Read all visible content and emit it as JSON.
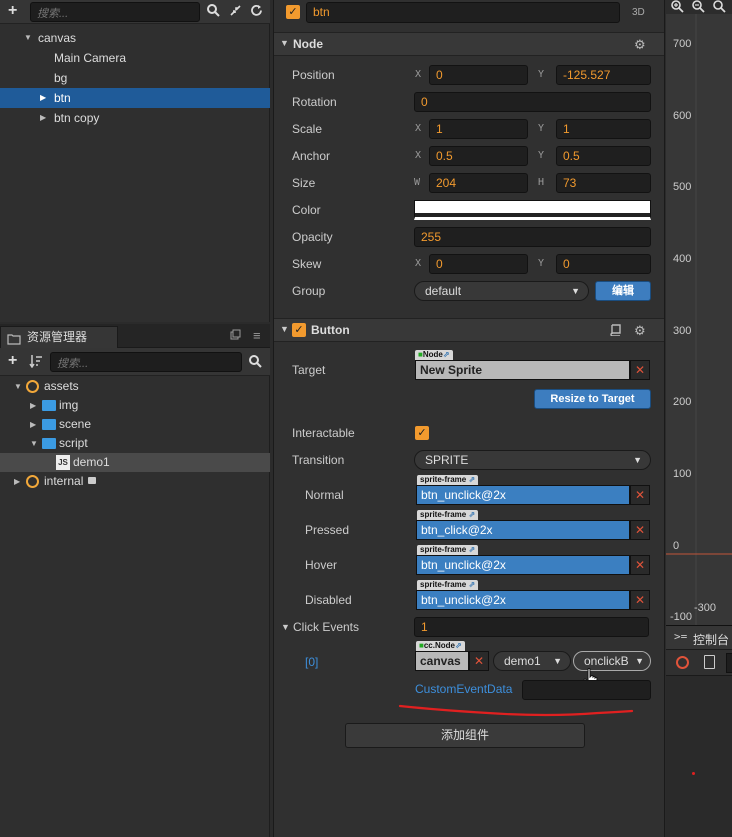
{
  "hierarchy": {
    "search_placeholder": "搜索...",
    "items": [
      {
        "label": "canvas"
      },
      {
        "label": "Main Camera"
      },
      {
        "label": "bg"
      },
      {
        "label": "btn"
      },
      {
        "label": "btn copy"
      }
    ]
  },
  "assets": {
    "title": "资源管理器",
    "search_placeholder": "搜索...",
    "items": [
      {
        "label": "assets"
      },
      {
        "label": "img"
      },
      {
        "label": "scene"
      },
      {
        "label": "script"
      },
      {
        "label": "demo1"
      },
      {
        "label": "internal"
      }
    ]
  },
  "inspector": {
    "node_name": "btn",
    "mode_label": "3D",
    "node_section": "Node",
    "position": {
      "label": "Position",
      "x_axis": "X",
      "x": "0",
      "y_axis": "Y",
      "y": "-125.527"
    },
    "rotation": {
      "label": "Rotation",
      "value": "0"
    },
    "scale": {
      "label": "Scale",
      "x_axis": "X",
      "x": "1",
      "y_axis": "Y",
      "y": "1"
    },
    "anchor": {
      "label": "Anchor",
      "x_axis": "X",
      "x": "0.5",
      "y_axis": "Y",
      "y": "0.5"
    },
    "size": {
      "label": "Size",
      "w_axis": "W",
      "w": "204",
      "h_axis": "H",
      "h": "73"
    },
    "color": {
      "label": "Color",
      "value": "#ffffff"
    },
    "opacity": {
      "label": "Opacity",
      "value": "255"
    },
    "skew": {
      "label": "Skew",
      "x_axis": "X",
      "x": "0",
      "y_axis": "Y",
      "y": "0"
    },
    "group": {
      "label": "Group",
      "value": "default",
      "edit_button": "编辑"
    },
    "button_section": "Button",
    "target": {
      "label": "Target",
      "tag": "Node",
      "value": "New Sprite"
    },
    "resize_button": "Resize to Target",
    "interactable": {
      "label": "Interactable",
      "checked": true
    },
    "transition": {
      "label": "Transition",
      "value": "SPRITE"
    },
    "sprite_tag": "sprite-frame",
    "normal": {
      "label": "Normal",
      "value": "btn_unclick@2x"
    },
    "pressed": {
      "label": "Pressed",
      "value": "btn_click@2x"
    },
    "hover": {
      "label": "Hover",
      "value": "btn_unclick@2x"
    },
    "disabled": {
      "label": "Disabled",
      "value": "btn_unclick@2x"
    },
    "click_events": {
      "label": "Click Events",
      "count": "1"
    },
    "event0": {
      "index": "[0]",
      "tag": "cc.Node",
      "target": "canvas",
      "component": "demo1",
      "handler": "onclickB"
    },
    "custom_event_data": {
      "label": "CustomEventData",
      "value": ""
    },
    "add_component": "添加组件"
  },
  "scene": {
    "y_labels": [
      "700",
      "600",
      "500",
      "400",
      "300",
      "200",
      "100",
      "0",
      "-100"
    ],
    "x_label": "-300"
  },
  "console": {
    "title": "控制台"
  },
  "colors": {
    "accent": "#f29a2e",
    "selection": "#1f5b99",
    "blue_button": "#3d7dbf",
    "remove_x": "#e0533a",
    "annotation_red": "#e02020"
  }
}
